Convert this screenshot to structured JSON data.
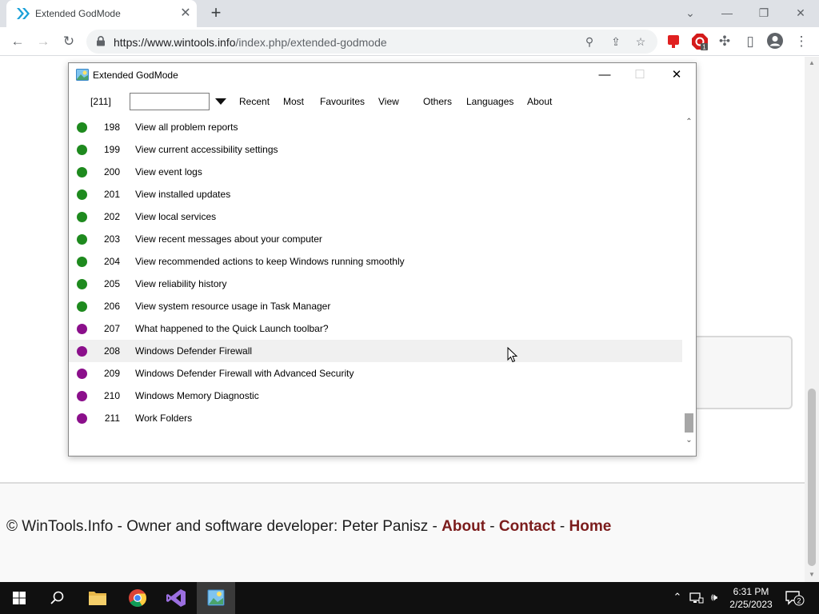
{
  "browser": {
    "tab_title": "Extended GodMode",
    "url_host": "https://www.wintools.info",
    "url_path": "/index.php/extended-godmode"
  },
  "footer": {
    "text": "© WinTools.Info - Owner and software developer: Peter Panisz - ",
    "about": "About",
    "sep1": " - ",
    "contact": "Contact",
    "sep2": " - ",
    "home": "Home"
  },
  "dialog": {
    "title": "Extended GodMode",
    "count": "[211]",
    "search_value": "",
    "menu": [
      "Recent",
      "Most",
      "Favourites",
      "View",
      "Others",
      "Languages",
      "About"
    ],
    "items": [
      {
        "num": "198",
        "label": "View all problem reports",
        "color": "#1e8a1e"
      },
      {
        "num": "199",
        "label": "View current accessibility settings",
        "color": "#1e8a1e"
      },
      {
        "num": "200",
        "label": "View event logs",
        "color": "#1e8a1e"
      },
      {
        "num": "201",
        "label": "View installed updates",
        "color": "#1e8a1e"
      },
      {
        "num": "202",
        "label": "View local services",
        "color": "#1e8a1e"
      },
      {
        "num": "203",
        "label": "View recent messages about your computer",
        "color": "#1e8a1e"
      },
      {
        "num": "204",
        "label": "View recommended actions to keep Windows running smoothly",
        "color": "#1e8a1e"
      },
      {
        "num": "205",
        "label": "View reliability history",
        "color": "#1e8a1e"
      },
      {
        "num": "206",
        "label": "View system resource usage in Task Manager",
        "color": "#1e8a1e"
      },
      {
        "num": "207",
        "label": "What happened to the Quick Launch toolbar?",
        "color": "#8b0f8b"
      },
      {
        "num": "208",
        "label": "Windows Defender Firewall",
        "color": "#8b0f8b"
      },
      {
        "num": "209",
        "label": "Windows Defender Firewall with Advanced Security",
        "color": "#8b0f8b"
      },
      {
        "num": "210",
        "label": "Windows Memory Diagnostic",
        "color": "#8b0f8b"
      },
      {
        "num": "211",
        "label": "Work Folders",
        "color": "#8b0f8b"
      }
    ],
    "hovered_index": 10
  },
  "taskbar": {
    "time": "6:31 PM",
    "date": "2/25/2023",
    "notification_count": "2"
  },
  "extension_badge": "1"
}
